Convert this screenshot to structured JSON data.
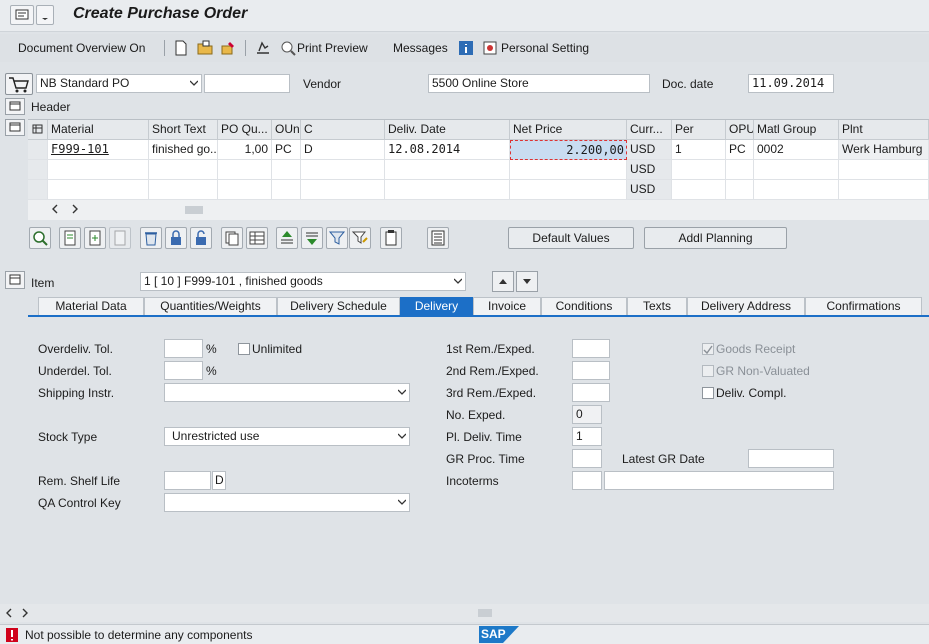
{
  "title": "Create Purchase Order",
  "toolbar": {
    "doc_overview": "Document Overview On",
    "print_preview": "Print Preview",
    "messages": "Messages",
    "personal_setting": "Personal Setting"
  },
  "header_row": {
    "doc_type": "NB Standard PO",
    "vendor_label": "Vendor",
    "vendor_value": "5500 Online Store",
    "doc_date_label": "Doc. date",
    "doc_date_value": "11.09.2014"
  },
  "header_section": "Header",
  "items_table": {
    "columns": [
      "Material",
      "Short Text",
      "PO Qu...",
      "OUn",
      "C",
      "Deliv. Date",
      "Net Price",
      "Curr...",
      "Per",
      "OPU",
      "Matl Group",
      "Plnt"
    ],
    "row1": {
      "material": "F999-101",
      "short_text": "finished go...",
      "qty": "1,00",
      "oun": "PC",
      "c": "D",
      "deliv_date": "12.08.2014",
      "net_price": "2.200,00",
      "curr": "USD",
      "per": "1",
      "opu": "PC",
      "matl_group": "0002",
      "plant": "Werk Hamburg"
    },
    "row2_curr": "USD",
    "row3_curr": "USD"
  },
  "buttons": {
    "default_values": "Default Values",
    "addl_planning": "Addl Planning"
  },
  "item_selector": {
    "label": "Item",
    "value": "1 [ 10 ] F999-101 , finished goods"
  },
  "tabs": [
    "Material Data",
    "Quantities/Weights",
    "Delivery Schedule",
    "Delivery",
    "Invoice",
    "Conditions",
    "Texts",
    "Delivery Address",
    "Confirmations"
  ],
  "delivery": {
    "overdeliv_label": "Overdeliv. Tol.",
    "underdel_label": "Underdel. Tol.",
    "percent": "%",
    "unlimited": "Unlimited",
    "shipping_label": "Shipping Instr.",
    "stock_type_label": "Stock Type",
    "stock_type_value": "Unrestricted use",
    "shelf_life_label": "Rem. Shelf Life",
    "shelf_unit": "D",
    "qa_label": "QA Control Key",
    "rem1_label": "1st Rem./Exped.",
    "rem2_label": "2nd Rem./Exped.",
    "rem3_label": "3rd Rem./Exped.",
    "no_exped_label": "No. Exped.",
    "no_exped_value": "0",
    "pl_deliv_label": "Pl. Deliv. Time",
    "pl_deliv_value": "1",
    "gr_proc_label": "GR Proc. Time",
    "latest_gr_label": "Latest GR Date",
    "incoterms_label": "Incoterms",
    "goods_receipt": "Goods Receipt",
    "gr_non_valuated": "GR Non-Valuated",
    "deliv_compl": "Deliv. Compl."
  },
  "status": {
    "message": "Not possible to determine any components",
    "logo": "SAP"
  },
  "colors": {
    "accent": "#1c6fc7",
    "error": "#d0021b"
  }
}
